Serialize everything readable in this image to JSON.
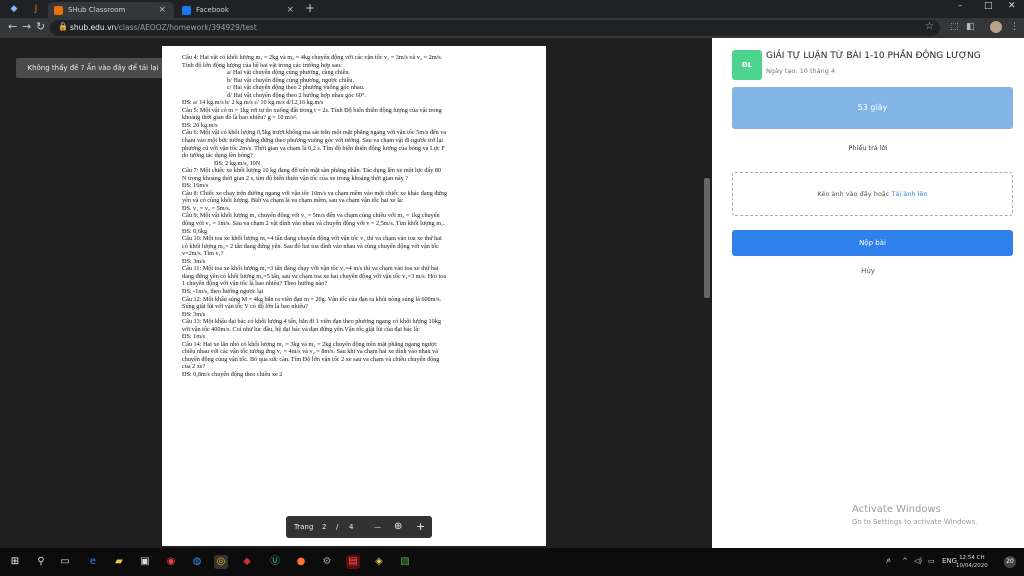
{
  "browser": {
    "tabs": [
      {
        "label": "SHub Classroom",
        "close": "×"
      },
      {
        "label": "Facebook",
        "close": "×"
      }
    ],
    "new_tab": "+",
    "url_host": "shub.edu.vn",
    "url_path": "/class/AEOOZ/homework/394929/test",
    "window_controls": [
      "–",
      "□",
      "✕"
    ]
  },
  "viewer": {
    "report_button": "Không thấy đề ? Ấn vào đây để tải lại",
    "pager": {
      "label": "Trang",
      "current": "2",
      "sep": "/",
      "total": "4",
      "zoom_out": "—",
      "zoom_in": "+"
    }
  },
  "document": {
    "lines": [
      "Câu 4: Hai vật có khối lượng m₁ = 2kg và m₂ = 4kg chuyển động với các vận tốc v₁ = 3m/s và v₂ = 2m/s.",
      "Tính độ lớn động lượng của hệ hai vật trong các trường hợp sau:",
      "a/ Hai vật chuyển động cùng phương, cùng chiều.",
      "b/ Hai vật chuyển động cùng phương, ngược chiều.",
      "c/ Hai vật chuyển động theo 2 phương vuông góc nhau.",
      "d/ Hai vật chuyển động theo 2 hướng hợp nhau góc 60°.",
      "ĐS: a/ 14 kg.m/s        b/ 2 kg.m/s     c/ 10 kg.m/s   d/12,16 kg.m/s",
      "Câu 5: Một vật có m = 1kg rơi tự do xuống đất trong t = 2s. Tính Độ biến thiên động lượng của vật trong",
      "khoảng thời gian đó là bao nhiêu? g = 10 m/s².",
      "ĐS: 20 kg.m/s",
      "Câu 6: Một vật có khối lượng 0,5kg trượt không ma sát trên một mặt phẳng ngang với vận tốc 5m/s đến va",
      "chạm vào một bức tường thẳng đứng theo phương vuông góc với tường. Sau va chạm vật đi ngược trở lại",
      "phương cũ với vận tốc 2m/s. Thời gian va chạm là 0,2 s. Tìm độ biến thiên động lượng của bóng và Lực F",
      "do tường tác dụng lên bóng?",
      "ĐS: 2 kg.m/s, 10N",
      "Câu 7: Một chiếc xe khối lượng 10 kg đang đỗ trên mặt sàn phẳng nhẵn. Tác dụng lên xe một lực đẩy 80",
      "N trong khoảng thời gian 2 s, tìm độ biến thiên vận tốc của xe trong khoảng thời gian này ?",
      "ĐS: 16m/s",
      "Câu 8: Chiếc xe chạy trên đường ngang với vận tốc 10m/s va chạm mềm vào một chiếc xe khác đang đứng",
      "yên và có cùng khối lượng. Biết va chạm là va chạm mềm, sau va chạm vận tốc hai xe là:",
      "ĐS. v₁ = v₂ = 5m/s.",
      "Câu 9: Một vật khối lượng m₁ chuyển động với v₁ = 5m/s đến va chạm cùng chiều với m₂ = 1kg chuyển",
      "động với v₂ = 1m/s. Sau va chạm 2 vật dính vào nhau và chuyển động với v = 2,5m/s. Tìm khối lượng m₁.",
      "ĐS: 0,6kg",
      "Câu 10: Một toa xe khối lượng m₁=4 tấn đang chuyển động với vận tốc v₁ thì va chạm vào toa xe thứ hai",
      "có khối lượng m₂= 2 tấn đang đứng yên. Sau đó hai toa dính vào nhau và cùng chuyển động với vận tốc",
      "v=2m/s. Tìm v₁?",
      "ĐS:      3m/s",
      "Câu 11: Một toa xe khối lượng m₁=3 tấn đang chạy với vận tốc v₁=4 m/s thì va chạm vào toa xe thứ hai",
      "đang đứng yên có khối lượng m₂=5 tấn, sau va chạm toa xe hai chuyển động với vận tốc v₂=3 m/s. Hỏi toa",
      "1 chuyển động với vận tốc là bao nhiêu? Theo hướng nào?",
      "ĐS:     -1m/s, theo hướng ngược lại",
      "Câu 12: Một khẩu súng M = 4kg bắn ra viên đạn m = 20g. Vận tốc của đạn ra khỏi nòng súng là 600m/s.",
      "Súng giật lùi với vận tốc V có độ lớn là bao nhiêu?",
      "ĐS: 3m/s",
      "Câu 13: Một khẩu đại bác có khối lượng 4 tấn, bắn đi 1 viên đạn theo phương ngang có khối lượng 10kg",
      "với vận tốc 400m/s. Coi như lúc đầu, hệ đại bác và đạn đứng yên.Vận tốc giật lùi của đại bác là:",
      "ĐS: 1m/s",
      "Câu 14: Hai xe lăn nhỏ có khối lượng m₁ = 3kg và m₂ = 2kg chuyển động trên mặt phẳng ngang ngược",
      "chiều nhau với các vận tốc tương ứng v₁ = 4m/s và v₂ = 8m/s. Sau khi va chạm hai xe dính vào nhau và",
      "chuyển động cùng vận tốc. Bỏ qua sức cản. Tìm Độ lớn vận tốc 2 xe sau va chạm và chiều chuyển động",
      "của 2 xe?",
      "ĐS: 0,8m/s chuyển động theo chiều xe 2"
    ]
  },
  "panel": {
    "avatar": "ĐL",
    "title": "GIẢI TỰ LUẬN TỪ BÀI 1-10 PHẦN ĐỘNG LƯỢNG",
    "date": "Ngày tạo: 10 tháng 4",
    "timer": "53 giây",
    "answer_sheet": "Phiếu trả lời",
    "dropzone_text": "Kéo ảnh vào đây hoặc ",
    "dropzone_link": "Tải ảnh lên",
    "submit": "Nộp bài",
    "cancel": "Hủy",
    "activate_title": "Activate Windows",
    "activate_sub": "Go to Settings to activate Windows."
  },
  "taskbar": {
    "lang": "ENG",
    "time": "12:54 CH",
    "date": "10/04/2020",
    "notifications": "20"
  },
  "colors": {
    "primary": "#2f80ed",
    "timer_bg": "#82b5e6",
    "avatar_bg": "#4cd48e"
  }
}
